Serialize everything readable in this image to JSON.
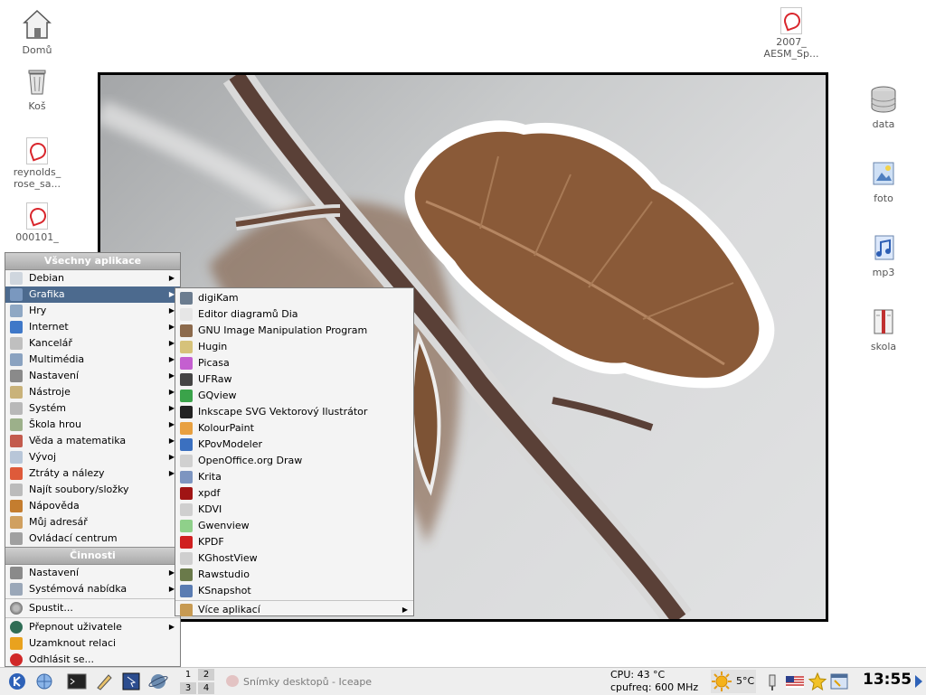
{
  "desktop_icons": {
    "home": "Domů",
    "trash": "Koš",
    "file1": [
      "reynolds_",
      "rose_sa..."
    ],
    "file2": "000101_",
    "file3": [
      "2007_",
      "AESM_Sp..."
    ],
    "data": "data",
    "foto": "foto",
    "mp3": "mp3",
    "skola": "skola"
  },
  "menu": {
    "header_all": "Všechny aplikace",
    "header_activities": "Činnosti",
    "categories": [
      {
        "label": "Debian",
        "icon": "debian-icon"
      },
      {
        "label": "Grafika",
        "icon": "graphics-icon"
      },
      {
        "label": "Hry",
        "icon": "games-icon"
      },
      {
        "label": "Internet",
        "icon": "internet-icon"
      },
      {
        "label": "Kancelář",
        "icon": "office-icon"
      },
      {
        "label": "Multimédia",
        "icon": "multimedia-icon"
      },
      {
        "label": "Nastavení",
        "icon": "settings-icon"
      },
      {
        "label": "Nástroje",
        "icon": "tools-icon"
      },
      {
        "label": "Systém",
        "icon": "system-icon"
      },
      {
        "label": "Škola hrou",
        "icon": "edu-icon"
      },
      {
        "label": "Věda a matematika",
        "icon": "science-icon"
      },
      {
        "label": "Vývoj",
        "icon": "development-icon"
      },
      {
        "label": "Ztráty a nálezy",
        "icon": "lost-found-icon"
      },
      {
        "label": "Najít soubory/složky",
        "icon": "find-icon"
      },
      {
        "label": "Nápověda",
        "icon": "help-icon"
      },
      {
        "label": "Můj adresář",
        "icon": "home-folder-icon"
      },
      {
        "label": "Ovládací centrum",
        "icon": "control-center-icon"
      }
    ],
    "activities": [
      {
        "label": "Nastavení",
        "icon": "settings-icon"
      },
      {
        "label": "Systémová nabídka",
        "icon": "system-menu-icon"
      }
    ],
    "run": "Spustit...",
    "switch_user": "Přepnout uživatele",
    "lock": "Uzamknout relaci",
    "logout": "Odhlásit se..."
  },
  "submenu": {
    "items": [
      {
        "label": "digiKam",
        "icon": "digikam-icon"
      },
      {
        "label": "Editor diagramů Dia",
        "icon": "dia-icon"
      },
      {
        "label": "GNU Image Manipulation Program",
        "icon": "gimp-icon"
      },
      {
        "label": "Hugin",
        "icon": "hugin-icon"
      },
      {
        "label": "Picasa",
        "icon": "picasa-icon"
      },
      {
        "label": "UFRaw",
        "icon": "ufraw-icon"
      },
      {
        "label": "GQview",
        "icon": "gqview-icon"
      },
      {
        "label": "Inkscape SVG Vektorový Ilustrátor",
        "icon": "inkscape-icon"
      },
      {
        "label": "KolourPaint",
        "icon": "kolourpaint-icon"
      },
      {
        "label": "KPovModeler",
        "icon": "kpovmodeler-icon"
      },
      {
        "label": "OpenOffice.org Draw",
        "icon": "ooo-draw-icon"
      },
      {
        "label": "Krita",
        "icon": "krita-icon"
      },
      {
        "label": "xpdf",
        "icon": "xpdf-icon"
      },
      {
        "label": "KDVI",
        "icon": "kdvi-icon"
      },
      {
        "label": "Gwenview",
        "icon": "gwenview-icon"
      },
      {
        "label": "KPDF",
        "icon": "kpdf-icon"
      },
      {
        "label": "KGhostView",
        "icon": "kghostview-icon"
      },
      {
        "label": "Rawstudio",
        "icon": "rawstudio-icon"
      },
      {
        "label": "KSnapshot",
        "icon": "ksnapshot-icon"
      }
    ],
    "more": "Více aplikací"
  },
  "taskbar": {
    "desktops": [
      "1",
      "2",
      "3",
      "4"
    ],
    "task_title": "Snímky desktopů - Iceape",
    "cpu_temp": "CPU: 43 °C",
    "cpu_freq": "cpufreq: 600 MHz",
    "weather_temp": "5°C",
    "clock": "13:55"
  },
  "colors": {
    "menu_highlight": "#4c6a8e",
    "menu_header": "#b0b0b0",
    "pdf_red": "#d9262c"
  }
}
